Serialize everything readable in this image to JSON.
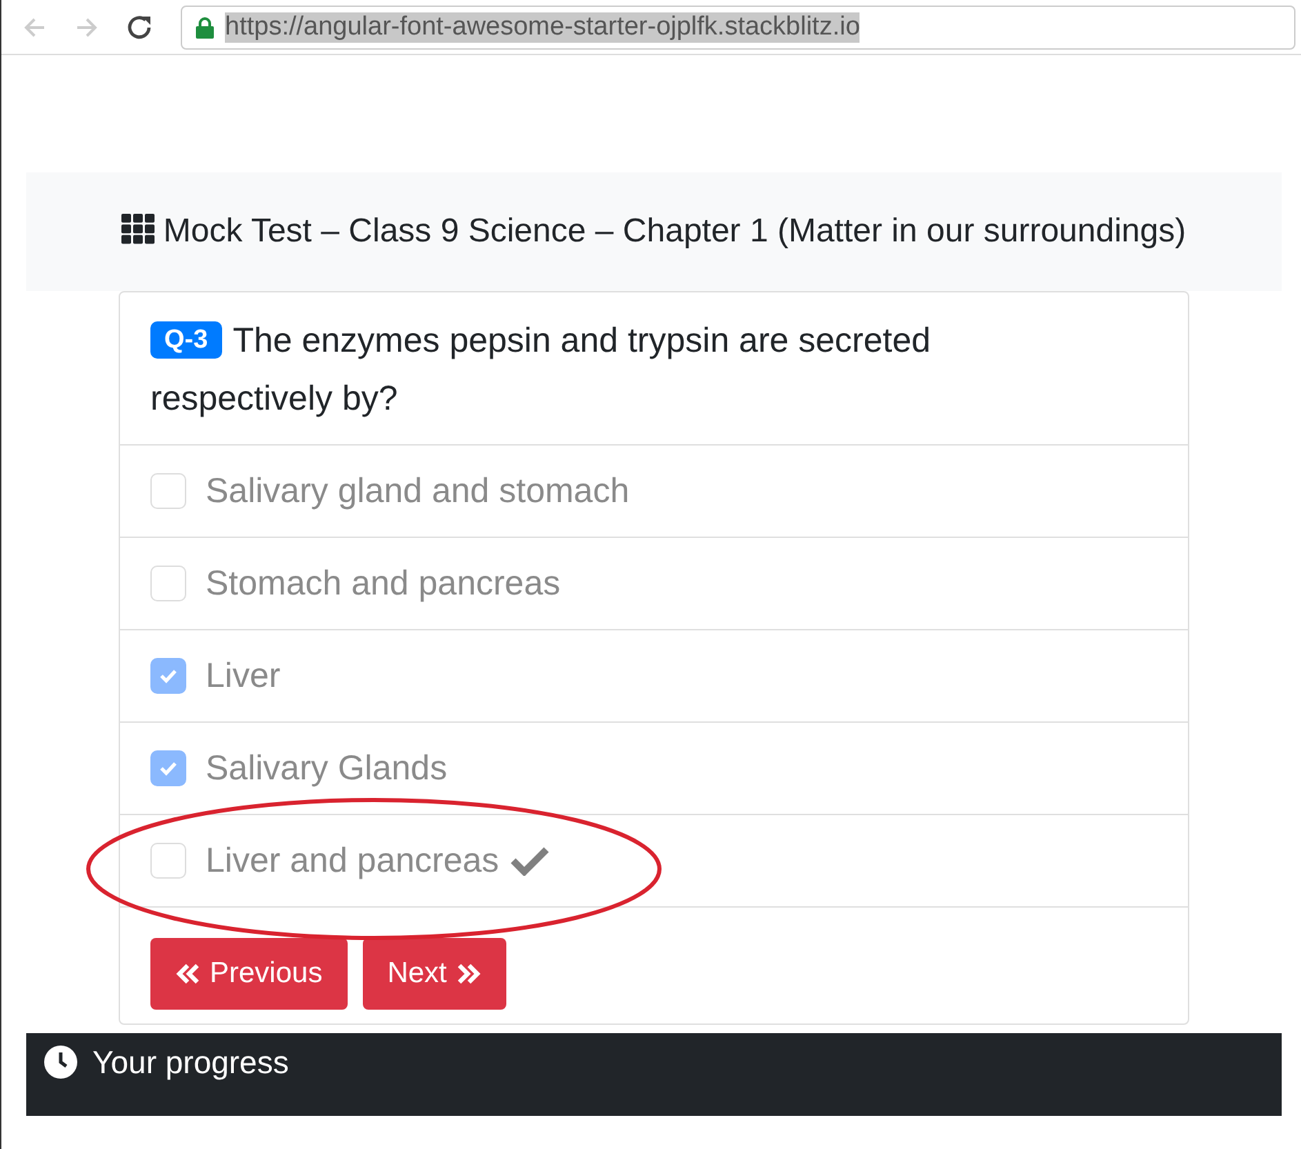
{
  "browser": {
    "url": "https://angular-font-awesome-starter-ojplfk.stackblitz.io"
  },
  "header": {
    "title": "Mock Test – Class 9 Science – Chapter 1 (Matter in our surroundings)"
  },
  "question": {
    "badge": "Q-3",
    "text": "The enzymes pepsin and trypsin are secreted respectively by?"
  },
  "options": [
    {
      "label": "Salivary gland and stomach",
      "checked": false,
      "correct": false,
      "circled": false
    },
    {
      "label": "Stomach and pancreas",
      "checked": false,
      "correct": false,
      "circled": false
    },
    {
      "label": "Liver",
      "checked": true,
      "correct": false,
      "circled": false
    },
    {
      "label": "Salivary Glands",
      "checked": true,
      "correct": false,
      "circled": false
    },
    {
      "label": "Liver and pancreas",
      "checked": false,
      "correct": true,
      "circled": true
    }
  ],
  "buttons": [
    {
      "label": "Previous",
      "kind": "prev"
    },
    {
      "label": "Next",
      "kind": "next"
    }
  ],
  "progress": {
    "title": "Your progress"
  }
}
